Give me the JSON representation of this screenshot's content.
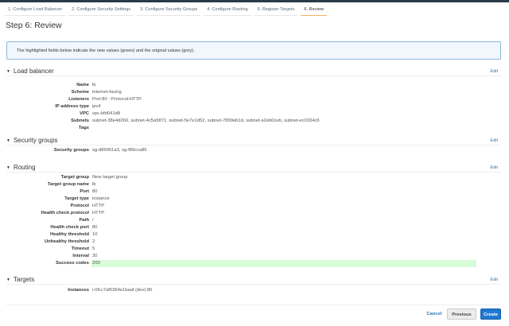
{
  "tabs": [
    "1. Configure Load Balancer",
    "2. Configure Security Settings",
    "3. Configure Security Groups",
    "4. Configure Routing",
    "5. Register Targets",
    "6. Review"
  ],
  "title": "Step 6: Review",
  "info": "The highlighted fields below indicate the new values (green) and the original values (grey).",
  "edit_label": "Edit",
  "sections": {
    "load_balancer": {
      "title": "Load balancer",
      "rows": [
        [
          "Name",
          "lb"
        ],
        [
          "Scheme",
          "internet-facing"
        ],
        [
          "Listeners",
          "Port:80 - Protocol:HTTP"
        ],
        [
          "IP address type",
          "ipv4"
        ],
        [
          "VPC",
          "vpc-bfd041d8"
        ],
        [
          "Subnets",
          "subnet-38e4d260, subnet-4c5a5871, subnet-5e7e1d52, subnet-7899eb1d, subnet-a2eb0ceb, subnet-ec0334c6"
        ],
        [
          "Tags",
          ""
        ]
      ]
    },
    "security_groups": {
      "title": "Security groups",
      "rows": [
        [
          "Security groups",
          "sg-d86061a3, sg-f89cca85"
        ]
      ]
    },
    "routing": {
      "title": "Routing",
      "rows": [
        [
          "Target group",
          "New target group"
        ],
        [
          "Target group name",
          "lb"
        ],
        [
          "Port",
          "80"
        ],
        [
          "Target type",
          "instance"
        ],
        [
          "Protocol",
          "HTTP"
        ],
        [
          "Health check protocol",
          "HTTP"
        ],
        [
          "Path",
          "/"
        ],
        [
          "Health check port",
          "80"
        ],
        [
          "Healthy threshold",
          "10"
        ],
        [
          "Unhealthy threshold",
          "2"
        ],
        [
          "Timeout",
          "5"
        ],
        [
          "Interval",
          "30"
        ],
        [
          "Success codes",
          "200"
        ]
      ]
    },
    "targets": {
      "title": "Targets",
      "rows": [
        [
          "Instances",
          "i-0fcc7af6364e1baaf (dev):80"
        ]
      ]
    }
  },
  "buttons": {
    "cancel": "Cancel",
    "previous": "Previous",
    "create": "Create"
  },
  "colors": {
    "accent": "#1f78d1",
    "highlight_new": "#d8fbd8",
    "tab_active": "#f7b35b"
  }
}
